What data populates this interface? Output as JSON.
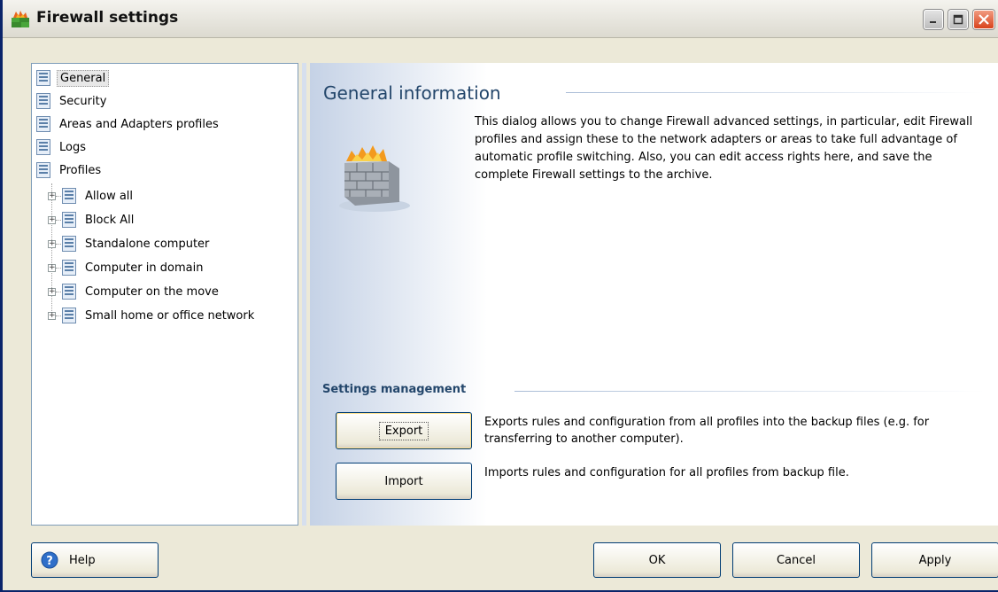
{
  "window": {
    "title": "Firewall settings"
  },
  "tree": {
    "items": [
      {
        "label": "General",
        "selected": true
      },
      {
        "label": "Security"
      },
      {
        "label": "Areas and Adapters profiles"
      },
      {
        "label": "Logs"
      },
      {
        "label": "Profiles"
      }
    ],
    "profiles": [
      {
        "label": "Allow all"
      },
      {
        "label": "Block All"
      },
      {
        "label": "Standalone computer"
      },
      {
        "label": "Computer in domain"
      },
      {
        "label": "Computer on the move"
      },
      {
        "label": "Small home or office network"
      }
    ]
  },
  "main": {
    "title": "General information",
    "description": "This dialog allows you to change Firewall advanced settings, in particular, edit Firewall profiles and assign these to the network adapters or areas to take full advantage of automatic profile switching. Also, you can edit access rights here, and save the complete Firewall settings to the archive.",
    "settings_title": "Settings management",
    "export_label": "Export",
    "export_desc": "Exports rules and configuration from all profiles into the backup files (e.g. for transferring to another computer).",
    "import_label": "Import",
    "import_desc": "Imports rules and configuration for all profiles from backup file."
  },
  "footer": {
    "help_label": "Help",
    "ok_label": "OK",
    "cancel_label": "Cancel",
    "apply_label": "Apply"
  },
  "colors": {
    "heading": "#23466b",
    "window_bg": "#ece9d8",
    "button_border": "#003c74"
  },
  "icons": {
    "title": "firewall-app-icon",
    "tree": "document-list-icon",
    "main": "firewall-wall-icon",
    "help": "help-icon"
  }
}
